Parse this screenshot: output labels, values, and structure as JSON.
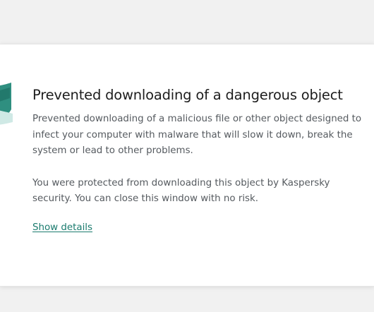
{
  "dialog": {
    "title": "Prevented downloading of a dangerous object",
    "description": "Prevented downloading of a malicious file or other object designed to infect your computer with malware that will slow it down, break the system or lead to other problems.",
    "protection_note": "You were protected from downloading this object by Kaspersky security. You can close this window with no risk.",
    "details_link": "Show details",
    "icon": "shield-icon"
  },
  "colors": {
    "accent": "#1a7b6e",
    "title": "#1d1d1d",
    "body_text": "#555a5f",
    "background": "#f1f1f1",
    "panel": "#ffffff"
  }
}
